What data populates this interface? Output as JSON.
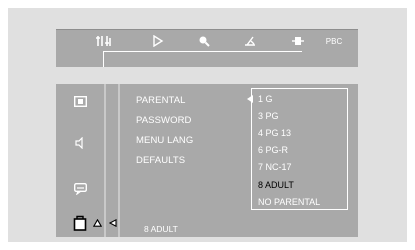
{
  "topbar": {
    "tabs": [
      {
        "icon": "audio-settings-icon"
      },
      {
        "icon": "play-icon"
      },
      {
        "icon": "zoom-icon"
      },
      {
        "icon": "angle-icon"
      },
      {
        "icon": "subtitle-icon"
      },
      {
        "icon": "pbc-icon",
        "label": "PBC"
      }
    ]
  },
  "sidebar": {
    "items": [
      {
        "icon": "display-icon"
      },
      {
        "icon": "speaker-icon"
      },
      {
        "icon": "subtitle-screen-icon"
      },
      {
        "icon": "lock-icon",
        "selected": true
      }
    ]
  },
  "menu": {
    "items": [
      "PARENTAL",
      "PASSWORD",
      "MENU LANG",
      "DEFAULTS"
    ]
  },
  "options": {
    "items": [
      "1 G",
      "3 PG",
      "4 PG 13",
      "6 PG-R",
      "7 NC-17",
      "8 ADULT",
      "NO PARENTAL"
    ],
    "selected": "8 ADULT"
  },
  "status": {
    "current_value": "8 ADULT"
  }
}
